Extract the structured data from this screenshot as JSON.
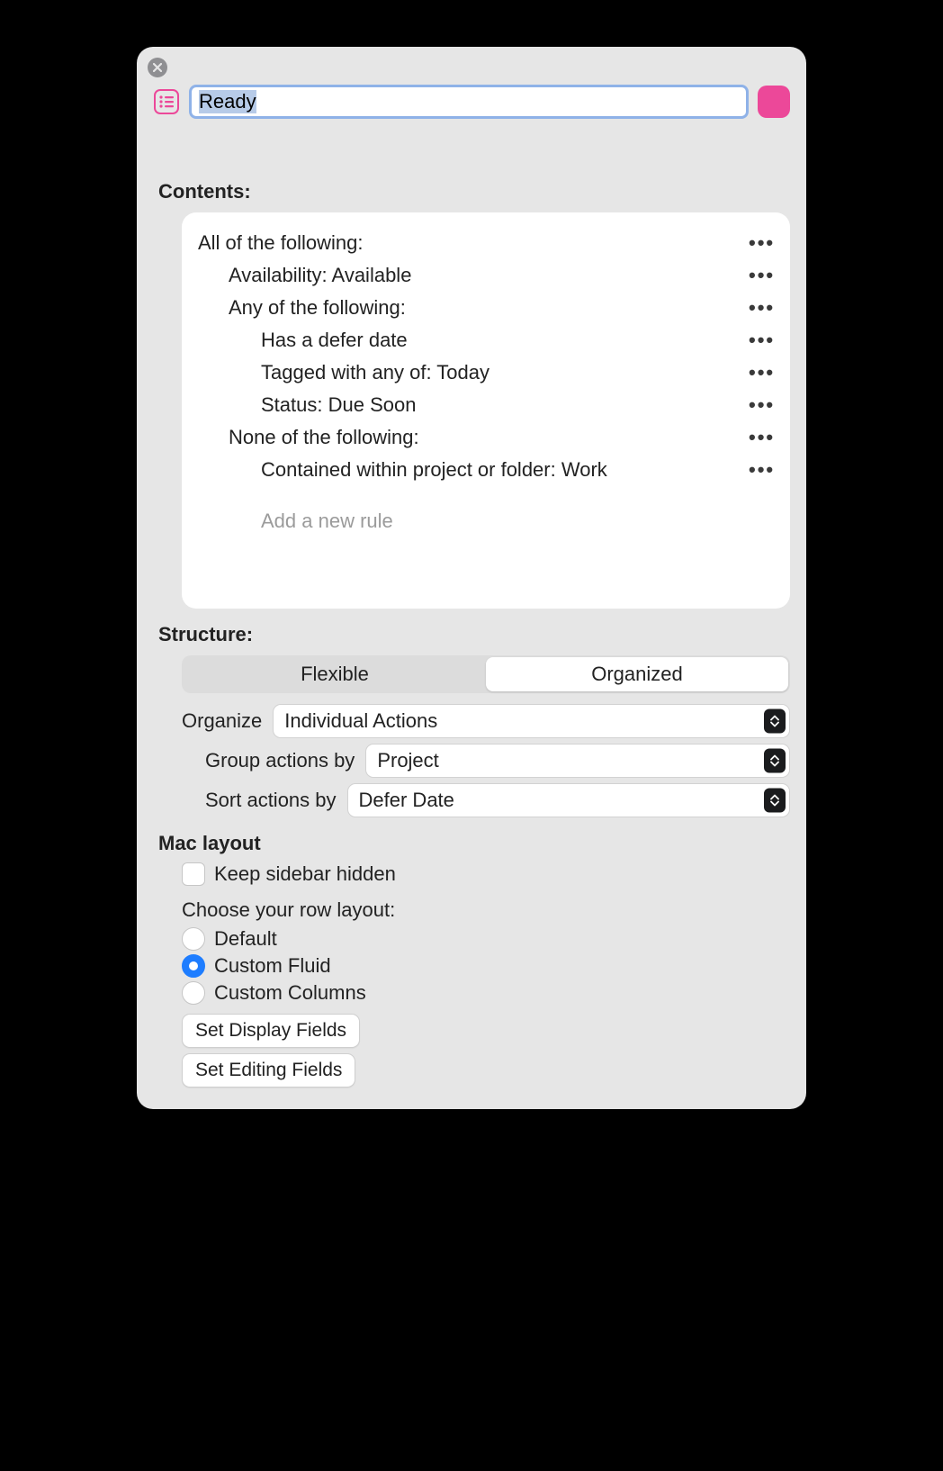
{
  "header": {
    "name_value": "Ready",
    "swatch_color": "#ec4899"
  },
  "contents": {
    "label": "Contents:",
    "rules": [
      {
        "text": "All of the following:",
        "indent": 0
      },
      {
        "text": "Availability: Available",
        "indent": 1
      },
      {
        "text": "Any of the following:",
        "indent": 1
      },
      {
        "text": "Has a defer date",
        "indent": 2
      },
      {
        "text": "Tagged with any of: Today",
        "indent": 2
      },
      {
        "text": "Status: Due Soon",
        "indent": 2
      },
      {
        "text": "None of the following:",
        "indent": 1
      },
      {
        "text": "Contained within project or folder: Work",
        "indent": 2
      }
    ],
    "add_rule": "Add a new rule"
  },
  "structure": {
    "label": "Structure:",
    "tabs": {
      "flexible": "Flexible",
      "organized": "Organized",
      "active": "organized"
    },
    "organize_label": "Organize",
    "organize_value": "Individual Actions",
    "group_label": "Group actions by",
    "group_value": "Project",
    "sort_label": "Sort actions by",
    "sort_value": "Defer Date"
  },
  "mac_layout": {
    "label": "Mac layout",
    "keep_sidebar_hidden": "Keep sidebar hidden",
    "row_layout_prompt": "Choose your row layout:",
    "options": {
      "default": "Default",
      "custom_fluid": "Custom Fluid",
      "custom_columns": "Custom Columns",
      "selected": "custom_fluid"
    },
    "set_display_fields": "Set Display Fields",
    "set_editing_fields": "Set Editing Fields"
  }
}
